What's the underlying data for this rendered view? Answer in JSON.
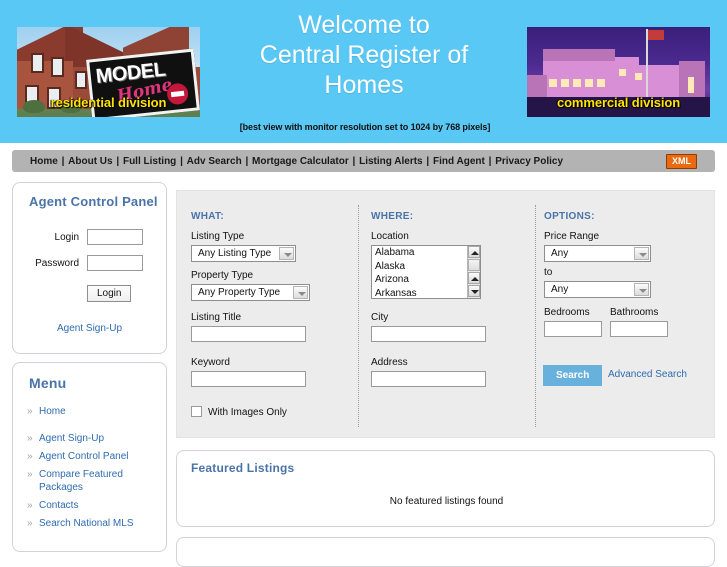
{
  "header": {
    "title_line1": "Welcome to",
    "title_line2": "Central Register of",
    "title_line3": "Homes",
    "note": "[best view with monitor resolution set to 1024 by 768 pixels]",
    "residential_caption": "residential division",
    "residential_sign_model": "MODEL",
    "residential_sign_home": "Home",
    "commercial_caption": "commercial division",
    "bg_color": "#5ac8f5"
  },
  "nav": {
    "items": [
      "Home",
      "About Us",
      "Full Listing",
      "Adv Search",
      "Mortgage Calculator",
      "Listing Alerts",
      "Find Agent",
      "Privacy Policy"
    ],
    "separator": "|",
    "xml_badge": "XML",
    "xml_badge_color": "#ea6a12"
  },
  "agent_control_panel": {
    "title": "Agent Control Panel",
    "login_label": "Login",
    "login_value": "",
    "password_label": "Password",
    "password_value": "",
    "login_button": "Login",
    "signup_link": "Agent Sign-Up"
  },
  "menu": {
    "title": "Menu",
    "chevron": "»",
    "items": [
      "Home",
      "Agent Sign-Up",
      "Agent Control Panel",
      "Compare Featured Packages",
      "Contacts",
      "Search National MLS"
    ]
  },
  "search": {
    "what_heading": "WHAT:",
    "where_heading": "WHERE:",
    "options_heading": "OPTIONS:",
    "listing_type_label": "Listing Type",
    "listing_type_value": "Any Listing Type",
    "property_type_label": "Property Type",
    "property_type_value": "Any Property Type",
    "listing_title_label": "Listing Title",
    "listing_title_value": "",
    "keyword_label": "Keyword",
    "keyword_value": "",
    "with_images_label": "With Images Only",
    "with_images_checked": false,
    "location_label": "Location",
    "location_options": [
      "Alabama",
      "Alaska",
      "Arizona",
      "Arkansas"
    ],
    "city_label": "City",
    "city_value": "",
    "address_label": "Address",
    "address_value": "",
    "price_range_label": "Price Range",
    "price_from_value": "Any",
    "price_to_label": "to",
    "price_to_value": "Any",
    "bedrooms_label": "Bedrooms",
    "bedrooms_value": "",
    "bathrooms_label": "Bathrooms",
    "bathrooms_value": "",
    "search_button": "Search",
    "advanced_search_link": "Advanced Search",
    "search_button_color": "#69b1dd",
    "panel_bg": "#ececec"
  },
  "featured": {
    "title": "Featured Listings",
    "empty_message": "No featured listings found"
  }
}
